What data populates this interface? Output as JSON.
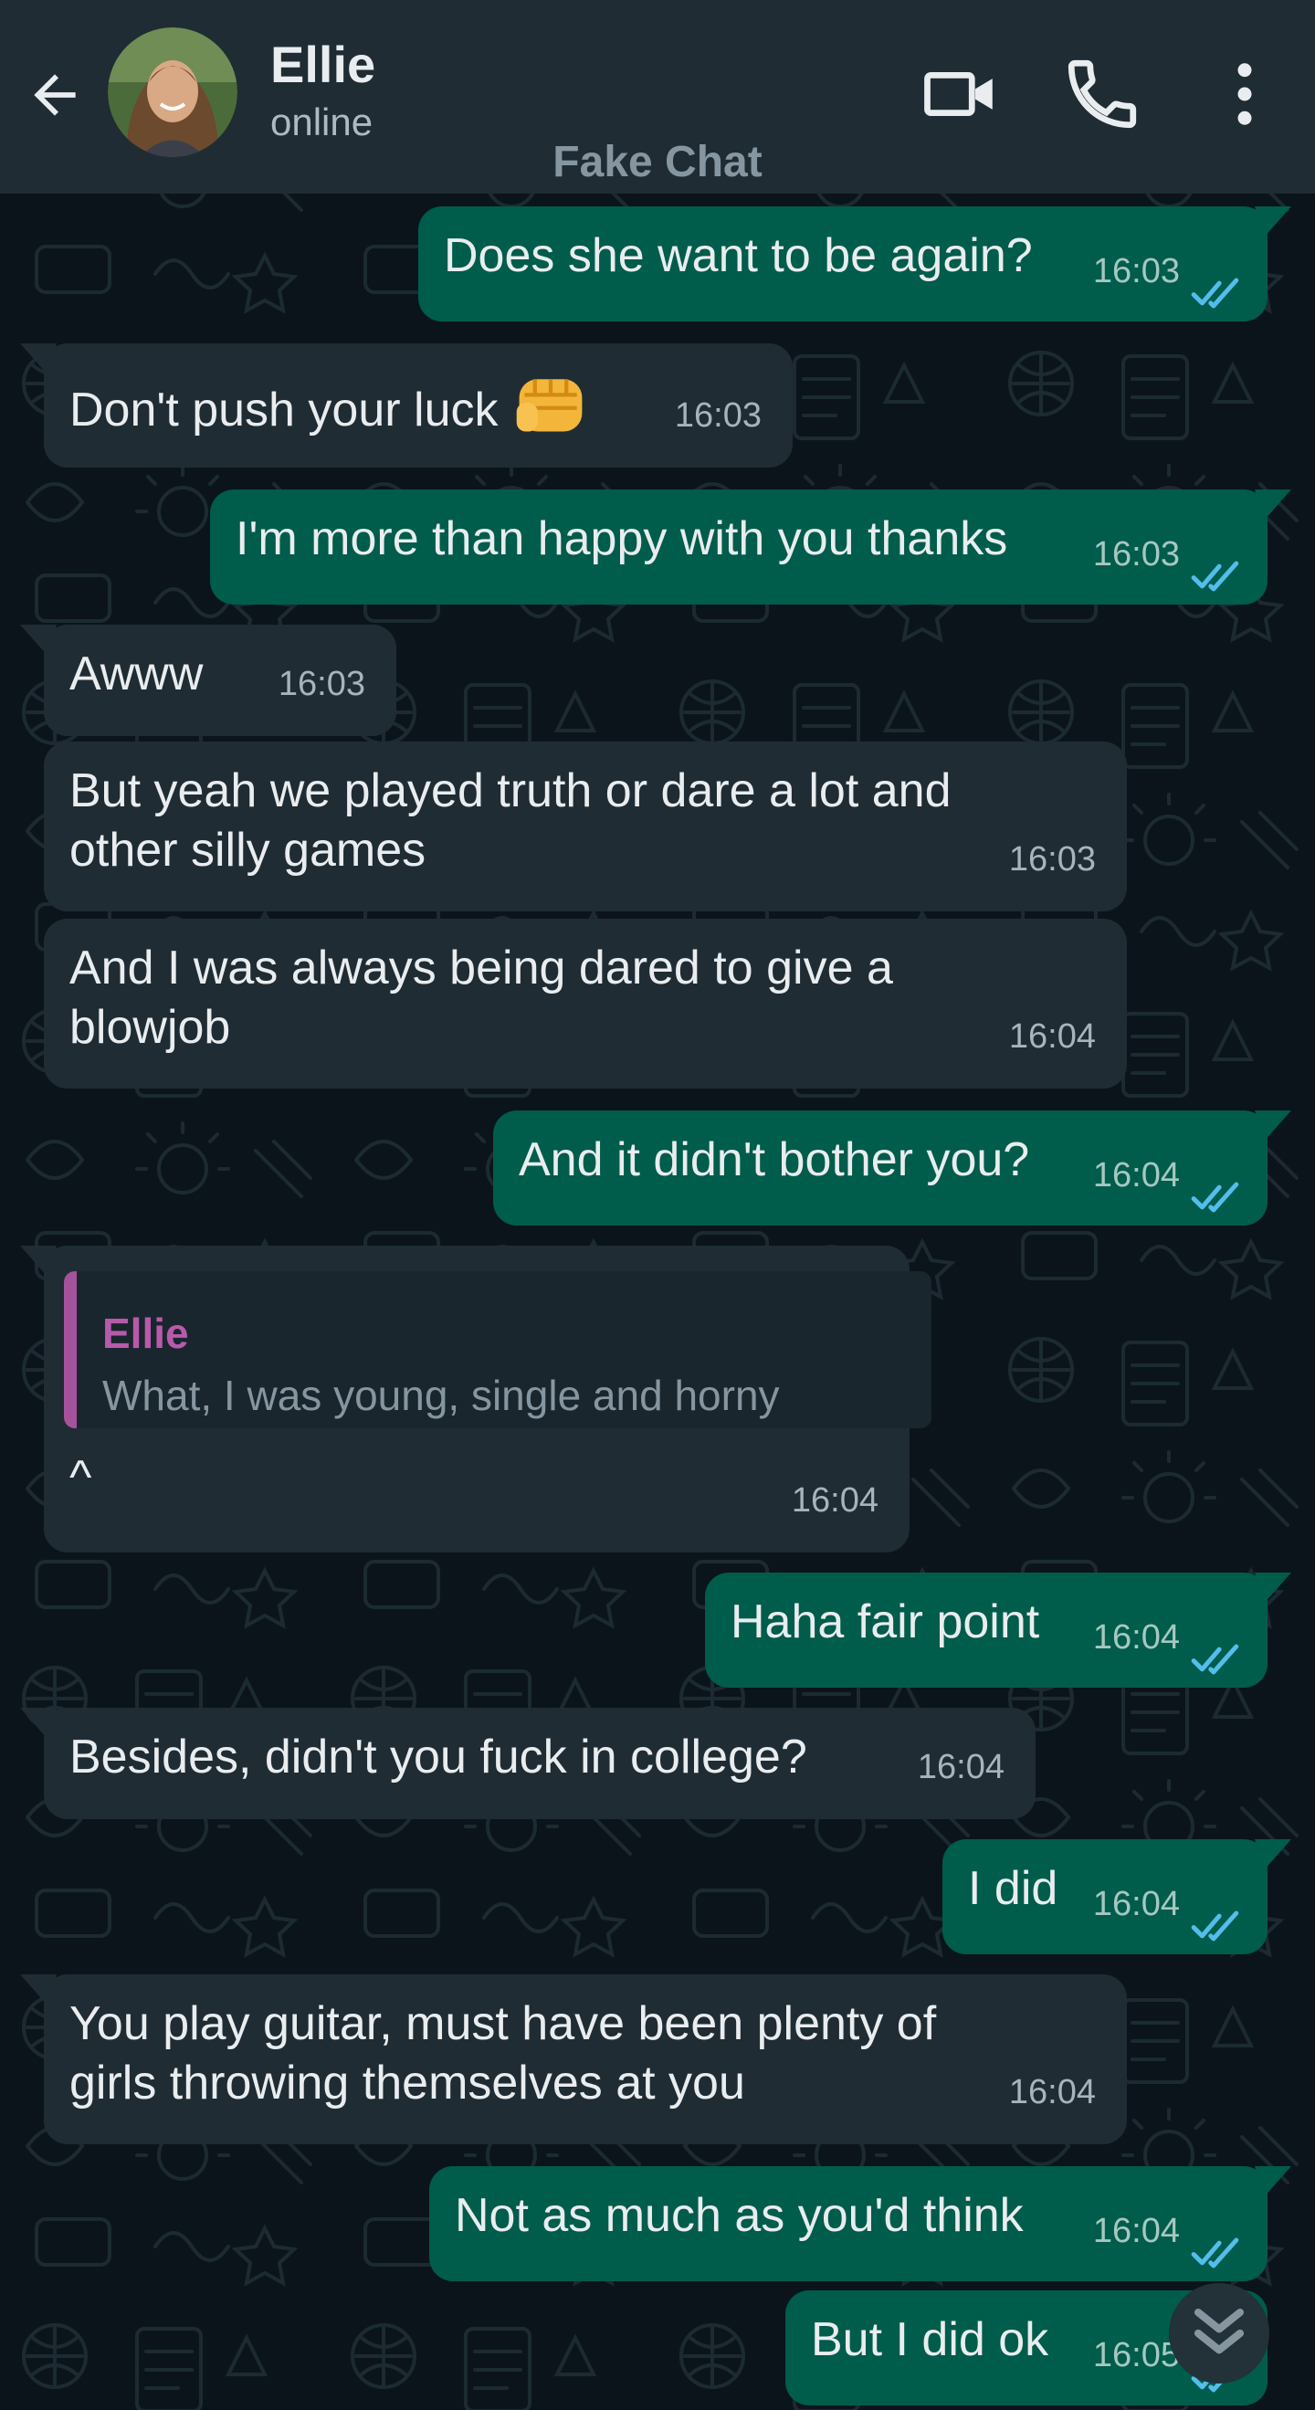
{
  "header": {
    "contact_name": "Ellie",
    "status": "online",
    "watermark": "Fake Chat",
    "icons": [
      "back-arrow-icon",
      "video-call-icon",
      "voice-call-icon",
      "more-vert-icon"
    ]
  },
  "colors": {
    "header_bg": "#1f2c34",
    "chat_bg": "#0b141a",
    "incoming_bubble": "#202c33",
    "outgoing_bubble": "#005c4b",
    "read_tick": "#53bdeb",
    "quote_accent": "#a5529d"
  },
  "messages": [
    {
      "direction": "out",
      "text": "Does she want to be again?",
      "time": "16:03",
      "status": "read"
    },
    {
      "direction": "in",
      "text": "Don't push your luck",
      "emoji": "oncoming-fist",
      "time": "16:03"
    },
    {
      "direction": "out",
      "text": "I'm more than happy with you thanks",
      "time": "16:03",
      "status": "read"
    },
    {
      "direction": "in",
      "text": "Awww",
      "time": "16:03"
    },
    {
      "direction": "in",
      "text": "But yeah we played truth or dare a lot and\nother silly games",
      "time": "16:03"
    },
    {
      "direction": "in",
      "text": "And I was always being dared to give a\nblowjob",
      "time": "16:04"
    },
    {
      "direction": "out",
      "text": "And it didn't bother you?",
      "time": "16:04",
      "status": "read"
    },
    {
      "direction": "in",
      "quote_author": "Ellie",
      "quote_text": "What, I was young, single and horny",
      "text": "^",
      "time": "16:04"
    },
    {
      "direction": "out",
      "text": "Haha fair point",
      "time": "16:04",
      "status": "read"
    },
    {
      "direction": "in",
      "text": "Besides, didn't you fuck in college?",
      "time": "16:04"
    },
    {
      "direction": "out",
      "text": "I did",
      "time": "16:04",
      "status": "read"
    },
    {
      "direction": "in",
      "text": "You play guitar, must have been plenty of\ngirls throwing themselves at you",
      "time": "16:04"
    },
    {
      "direction": "out",
      "text": "Not as much as you'd think",
      "time": "16:04",
      "status": "read"
    },
    {
      "direction": "out",
      "text": "But I did ok",
      "time": "16:05",
      "status": "read"
    }
  ],
  "scroll_button": {
    "icon": "double-chevron-down-icon"
  }
}
